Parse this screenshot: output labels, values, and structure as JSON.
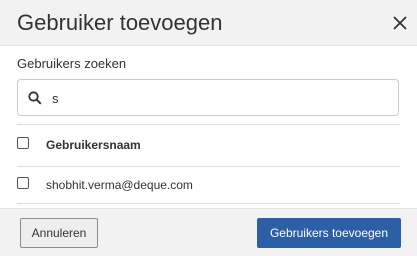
{
  "dialog": {
    "title": "Gebruiker toevoegen",
    "close_icon": "close-icon"
  },
  "search": {
    "label": "Gebruikers zoeken",
    "value": "s",
    "icon": "search-icon"
  },
  "table": {
    "columns": [
      "Gebruikersnaam"
    ],
    "rows": [
      {
        "username": "shobhit.verma@deque.com",
        "checked": false
      }
    ],
    "select_all_checked": false
  },
  "footer": {
    "cancel_label": "Annuleren",
    "add_label": "Gebruikers toevoegen"
  },
  "colors": {
    "primary_button": "#2d5fa6",
    "header_bg": "#f2f2f2"
  }
}
